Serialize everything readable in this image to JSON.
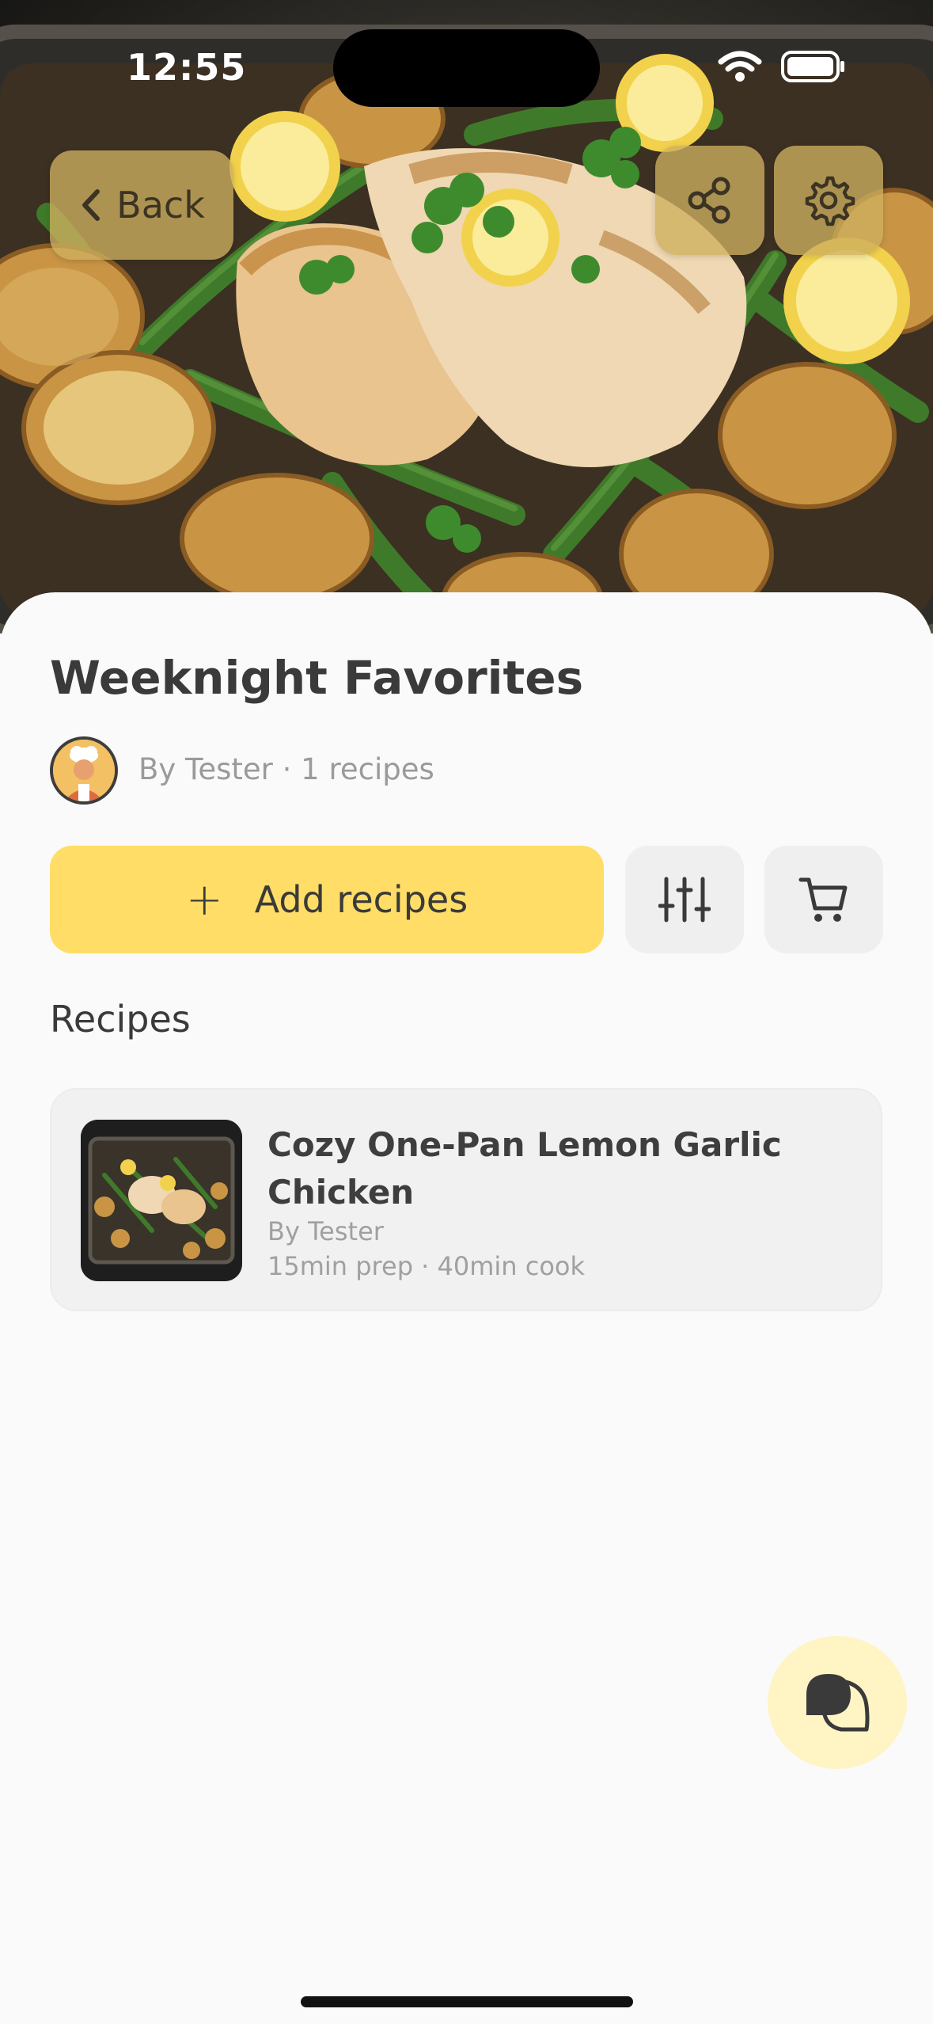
{
  "status_bar": {
    "time": "12:55"
  },
  "header": {
    "back_label": "Back",
    "share_icon": "share-icon",
    "settings_icon": "gear-icon"
  },
  "collection": {
    "title": "Weeknight Favorites",
    "byline": "By Tester · 1 recipes"
  },
  "actions": {
    "add_label": "Add recipes",
    "add_icon": "plus-icon",
    "filter_icon": "sliders-icon",
    "cart_icon": "cart-icon"
  },
  "recipes_section": {
    "title": "Recipes",
    "items": [
      {
        "title": "Cozy One-Pan Lemon Garlic Chicken",
        "author": "By Tester",
        "meta": "15min prep · 40min cook"
      }
    ]
  },
  "colors": {
    "accent": "#ffdd66",
    "fab_bg": "#fff4c4",
    "glass_button": "#cdaf5f"
  }
}
